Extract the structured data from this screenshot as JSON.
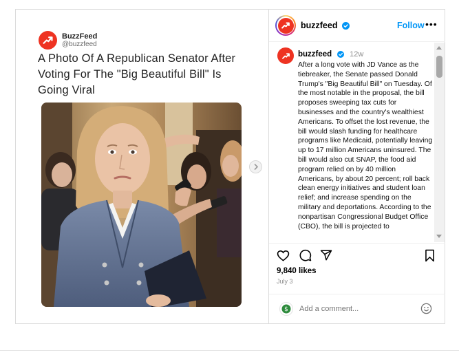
{
  "card": {
    "brand_name": "BuzzFeed",
    "brand_handle": "@buzzfeed",
    "headline": "A Photo Of A Republican Senator After Voting For The \"Big Beautiful Bill\" Is Going Viral"
  },
  "header": {
    "username": "buzzfeed",
    "follow_label": "Follow",
    "more_label": "•••"
  },
  "caption": {
    "username": "buzzfeed",
    "time": "12w",
    "text": "After a long vote with JD Vance as the tiebreaker, the Senate passed Donald Trump's \"Big Beautiful Bill\" on Tuesday. Of the most notable in the proposal, the bill proposes sweeping tax cuts for businesses and the country's wealthiest Americans. To offset the lost revenue, the bill would slash funding for healthcare programs like Medicaid, potentially leaving up to 17 million Americans uninsured. The bill would also cut SNAP, the food aid program relied on by 40 million Americans, by about 20 percent; roll back clean energy initiatives and student loan relief; and increase spending on the military and deportations. According to the nonpartisan Congressional Budget Office (CBO), the bill is projected to"
  },
  "engagement": {
    "likes": "9,840 likes",
    "date": "July 3"
  },
  "comment": {
    "placeholder": "Add a comment..."
  },
  "colors": {
    "brand_red": "#ee3322",
    "link_blue": "#0095f6",
    "border": "#dbdbdb"
  },
  "icons": [
    "buzzfeed-logo-icon",
    "verified-badge-icon",
    "more-options-icon",
    "heart-icon",
    "comment-icon",
    "share-icon",
    "bookmark-icon",
    "emoji-icon",
    "chevron-right-icon"
  ]
}
